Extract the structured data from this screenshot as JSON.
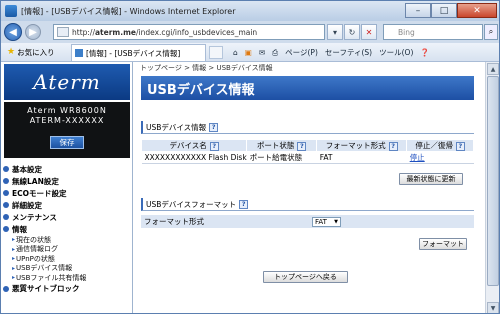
{
  "window": {
    "title": "[情報] - [USBデバイス情報] - Windows Internet Explorer",
    "buttons": {
      "minimize": "–",
      "maximize": "□",
      "close": "✕"
    }
  },
  "address": {
    "url_prefix": "http://",
    "url_host": "aterm.me",
    "url_path": "/index.cgi/info_usbdevices_main"
  },
  "search": {
    "placeholder": "Bing"
  },
  "command_bar": {
    "favorites": "お気に入り",
    "tab_title": "[情報] - [USBデバイス情報]",
    "page_menu": "ページ(P)",
    "safety_menu": "セーフティ(S)",
    "tools_menu": "ツール(O)"
  },
  "sidebar": {
    "logo": "Aterm",
    "model_line1": "Aterm WR8600N",
    "model_line2": "ATERM-XXXXXX",
    "save_label": "保存",
    "menu": [
      {
        "label": "基本設定"
      },
      {
        "label": "無線LAN設定"
      },
      {
        "label": "ECOモード設定"
      },
      {
        "label": "詳細設定"
      },
      {
        "label": "メンテナンス"
      },
      {
        "label": "情報"
      }
    ],
    "info_items": [
      {
        "label": "現在の状態"
      },
      {
        "label": "通信情報ログ"
      },
      {
        "label": "UPnPの状態"
      },
      {
        "label": "USBデバイス情報"
      },
      {
        "label": "USBファイル共有情報"
      }
    ],
    "last_menu": {
      "label": "悪質サイトブロック"
    }
  },
  "main": {
    "breadcrumb": "トップページ > 情報 > USBデバイス情報",
    "page_title": "USBデバイス情報",
    "section1_title": "USBデバイス情報",
    "table_headers": {
      "device_name": "デバイス名",
      "port_status": "ポート状態",
      "format": "フォーマット形式",
      "stop_restore": "停止／復帰"
    },
    "device_row": {
      "device_name": "XXXXXXXXXXXX Flash Disk",
      "port_status": "ポート給電状態",
      "format": "FAT",
      "action": "停止"
    },
    "refresh_button": "最新状態に更新",
    "section2_title": "USBデバイスフォーマット",
    "format_label": "フォーマット形式",
    "format_value": "FAT",
    "format_button": "フォーマット",
    "back_button": "トップページへ戻る"
  }
}
